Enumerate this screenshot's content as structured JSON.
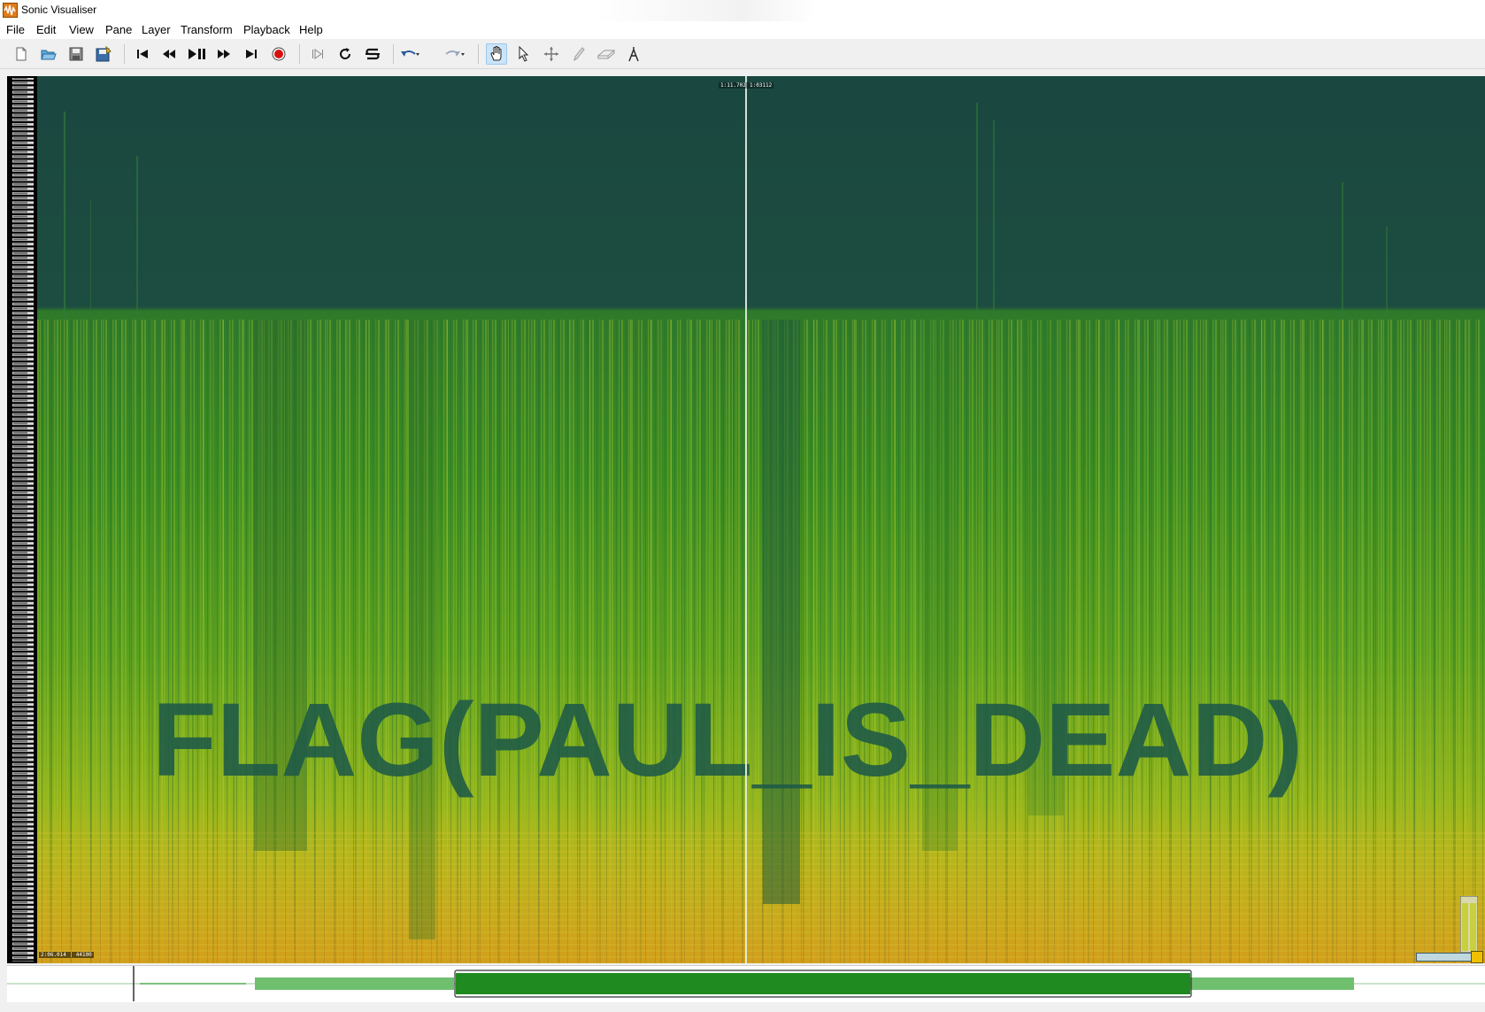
{
  "window": {
    "title": "Sonic Visualiser"
  },
  "menu": [
    {
      "label": "File"
    },
    {
      "label": "Edit"
    },
    {
      "label": "View"
    },
    {
      "label": "Pane"
    },
    {
      "label": "Layer"
    },
    {
      "label": "Transform"
    },
    {
      "label": "Playback"
    },
    {
      "label": "Help"
    }
  ],
  "toolbar": {
    "buttons": [
      {
        "icon": "new-document-icon"
      },
      {
        "icon": "open-folder-icon"
      },
      {
        "icon": "save-icon"
      },
      {
        "icon": "save-as-icon"
      },
      {
        "icon": "rewind-to-start-icon"
      },
      {
        "icon": "rewind-icon"
      },
      {
        "icon": "play-pause-icon"
      },
      {
        "icon": "fast-forward-icon"
      },
      {
        "icon": "fast-forward-to-end-icon"
      },
      {
        "icon": "record-icon"
      },
      {
        "icon": "play-selection-icon"
      },
      {
        "icon": "loop-icon"
      },
      {
        "icon": "solo-icon"
      },
      {
        "icon": "undo-icon"
      },
      {
        "icon": "redo-icon"
      },
      {
        "icon": "navigate-hand-icon"
      },
      {
        "icon": "select-arrow-icon"
      },
      {
        "icon": "move-cross-icon"
      },
      {
        "icon": "draw-pencil-icon"
      },
      {
        "icon": "erase-icon"
      },
      {
        "icon": "measure-icon"
      }
    ],
    "active_tool": "navigate-hand-icon"
  },
  "pane": {
    "time_label_left": "1:11.702",
    "time_label_right": "1:03112",
    "position_label": "2:06.014 | 44100",
    "hidden_message": "FLAG(PAUL_IS_DEAD)"
  },
  "colors": {
    "spectro_dark": "#1b4a40",
    "spectro_mid": "#3f8f22",
    "spectro_bright": "#b9c31f",
    "spectro_hot": "#e0961a",
    "text_overlay": "#1e5a48"
  }
}
